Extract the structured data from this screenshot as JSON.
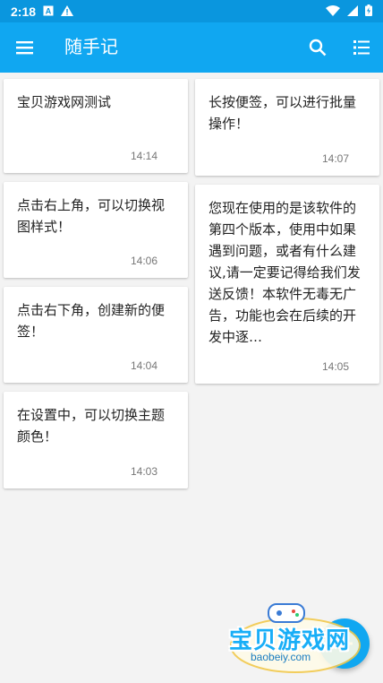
{
  "status_bar": {
    "time": "2:18",
    "icons": [
      "notification-a-icon",
      "warning-icon",
      "wifi-icon",
      "signal-icon",
      "battery-charging-icon"
    ]
  },
  "app_bar": {
    "title": "随手记",
    "color": "#10a7f1",
    "left_icon": "menu-icon",
    "right_icons": [
      "search-icon",
      "list-view-icon"
    ]
  },
  "notes": {
    "left": [
      {
        "text": "宝贝游戏网测试",
        "time": "14:14"
      },
      {
        "text": "点击右上角，可以切换视图样式！",
        "time": "14:06"
      },
      {
        "text": "点击右下角，创建新的便签！",
        "time": "14:04"
      },
      {
        "text": "在设置中，可以切换主题颜色！",
        "time": "14:03"
      }
    ],
    "right": [
      {
        "text": "长按便签，可以进行批量操作！",
        "time": "14:07"
      },
      {
        "text": "您现在使用的是该软件的第四个版本，使用中如果遇到问题，或者有什么建议,请一定要记得给我们发送反馈！本软件无毒无广告，功能也会在后续的开发中逐…",
        "time": "14:05"
      }
    ]
  },
  "fab": {
    "icon": "add-icon"
  },
  "watermark": {
    "text": "宝贝游戏网",
    "sub": "baobeiy.com"
  }
}
